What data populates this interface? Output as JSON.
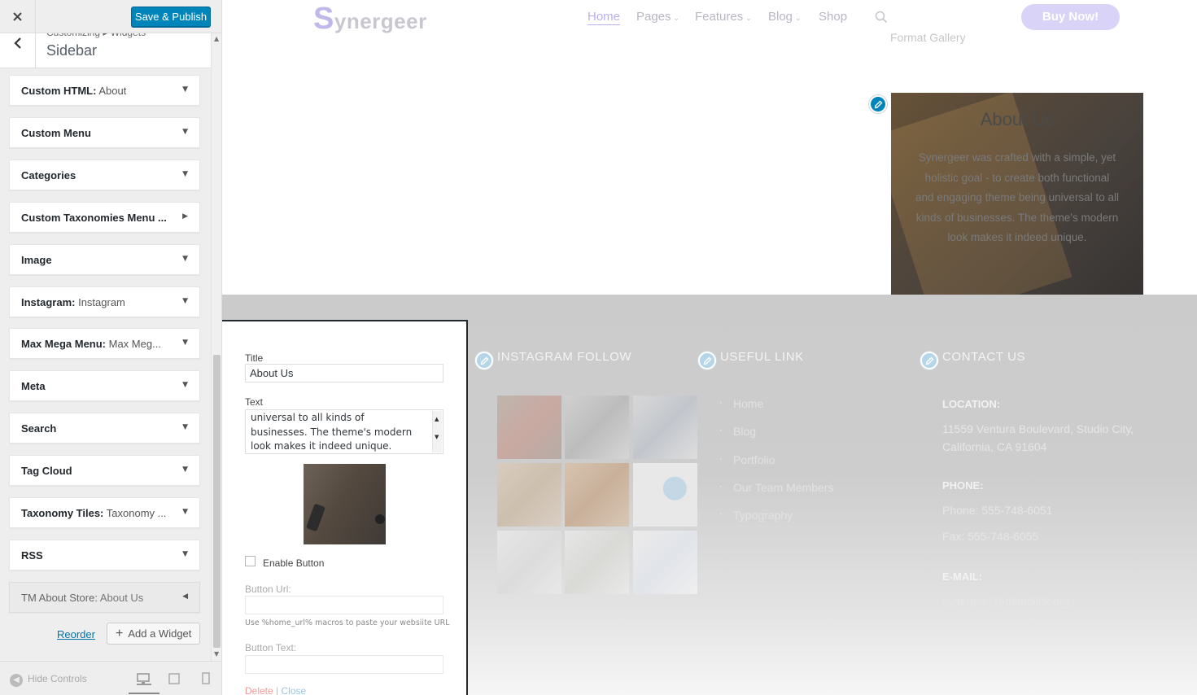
{
  "panel": {
    "close_icon": "close-icon",
    "save_label": "Save & Publish",
    "breadcrumb": "Customizing ▸ Widgets",
    "section_title": "Sidebar",
    "widgets": [
      {
        "name": "Custom HTML:",
        "sub": " About",
        "state": "collapsed"
      },
      {
        "name": "Custom Menu",
        "sub": "",
        "state": "collapsed"
      },
      {
        "name": "Categories",
        "sub": "",
        "state": "collapsed"
      },
      {
        "name": "Custom Taxonomies Menu ...",
        "sub": "",
        "state": "collapsed-right"
      },
      {
        "name": "Image",
        "sub": "",
        "state": "collapsed"
      },
      {
        "name": "Instagram:",
        "sub": " Instagram",
        "state": "collapsed"
      },
      {
        "name": "Max Mega Menu:",
        "sub": " Max Meg...",
        "state": "collapsed"
      },
      {
        "name": "Meta",
        "sub": "",
        "state": "collapsed"
      },
      {
        "name": "Search",
        "sub": "",
        "state": "collapsed"
      },
      {
        "name": "Tag Cloud",
        "sub": "",
        "state": "collapsed"
      },
      {
        "name": "Taxonomy Tiles:",
        "sub": " Taxonomy ...",
        "state": "collapsed"
      },
      {
        "name": "RSS",
        "sub": "",
        "state": "collapsed"
      },
      {
        "name": "TM About Store:",
        "sub": " About Us",
        "state": "expanded"
      }
    ],
    "reorder_label": "Reorder",
    "add_widget_label": "Add a Widget",
    "hide_controls_label": "Hide Controls"
  },
  "form": {
    "title_label": "Title",
    "title_value": "About Us",
    "text_label": "Text",
    "text_value": "universal to all kinds of businesses. The theme's modern look makes it indeed unique.",
    "enable_button_label": "Enable Button",
    "button_url_label": "Button Url:",
    "button_url_value": "",
    "button_url_hint": "Use %home_url% macros to paste your websiite URL",
    "button_text_label": "Button Text:",
    "button_text_value": "",
    "delete_label": "Delete",
    "separator": " | ",
    "close_label": "Close"
  },
  "site": {
    "logo_s": "S",
    "logo_rest": "ynergeer",
    "nav": [
      {
        "label": "Home",
        "active": true,
        "caret": false
      },
      {
        "label": "Pages",
        "active": false,
        "caret": true
      },
      {
        "label": "Features",
        "active": false,
        "caret": true
      },
      {
        "label": "Blog",
        "active": false,
        "caret": true
      },
      {
        "label": "Shop",
        "active": false,
        "caret": false
      }
    ],
    "buy_label": "Buy Now!",
    "format_gallery": "Format Gallery",
    "about": {
      "title": "About Us",
      "text": "Synergeer was crafted with a simple, yet holistic goal - to create both functional and engaging theme being universal to all kinds of businesses. The theme's modern look makes it indeed unique."
    },
    "footer": {
      "instagram_heading": "INSTAGRAM FOLLOW",
      "links_heading": "USEFUL LINK",
      "contact_heading": "CONTACT US",
      "links": [
        "Home",
        "Blog",
        "Portfolio",
        "Our Team Members",
        "Typography"
      ],
      "location_label": "LOCATION:",
      "location_line1": "11559 Ventura Boulevard, Studio City,",
      "location_line2": "California, CA 91604",
      "phone_label": "PHONE:",
      "phone_value": "Phone: 555-748-6051",
      "fax_value": "Fax: 555-748-6055",
      "email_label": "E-MAIL:",
      "email_value": "synergeer@demolink.org"
    }
  },
  "colors": {
    "primary": "#0085ba",
    "accent": "#8c7fd8",
    "panel_bg": "#eeeeee"
  }
}
